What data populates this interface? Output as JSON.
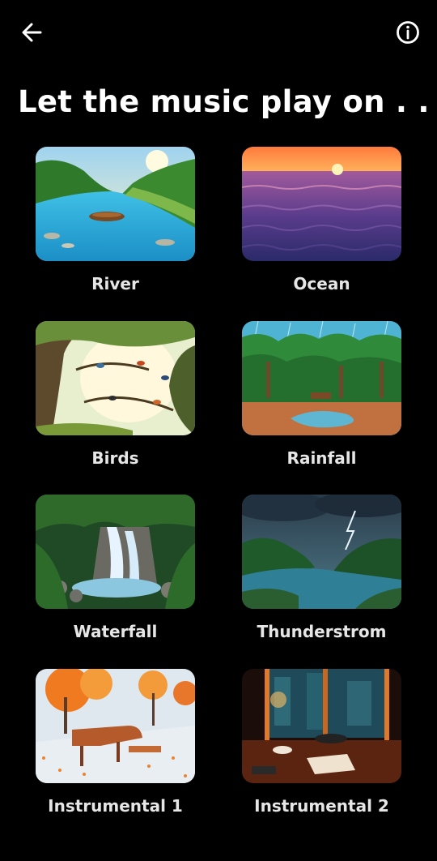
{
  "header": {
    "back_icon": "arrow-left-icon",
    "info_icon": "info-circle-icon",
    "title": "Let the music play on . . ."
  },
  "sounds": [
    {
      "label": "River"
    },
    {
      "label": "Ocean"
    },
    {
      "label": "Birds"
    },
    {
      "label": "Rainfall"
    },
    {
      "label": "Waterfall"
    },
    {
      "label": "Thunderstrom"
    },
    {
      "label": "Instrumental 1"
    },
    {
      "label": "Instrumental 2"
    }
  ]
}
